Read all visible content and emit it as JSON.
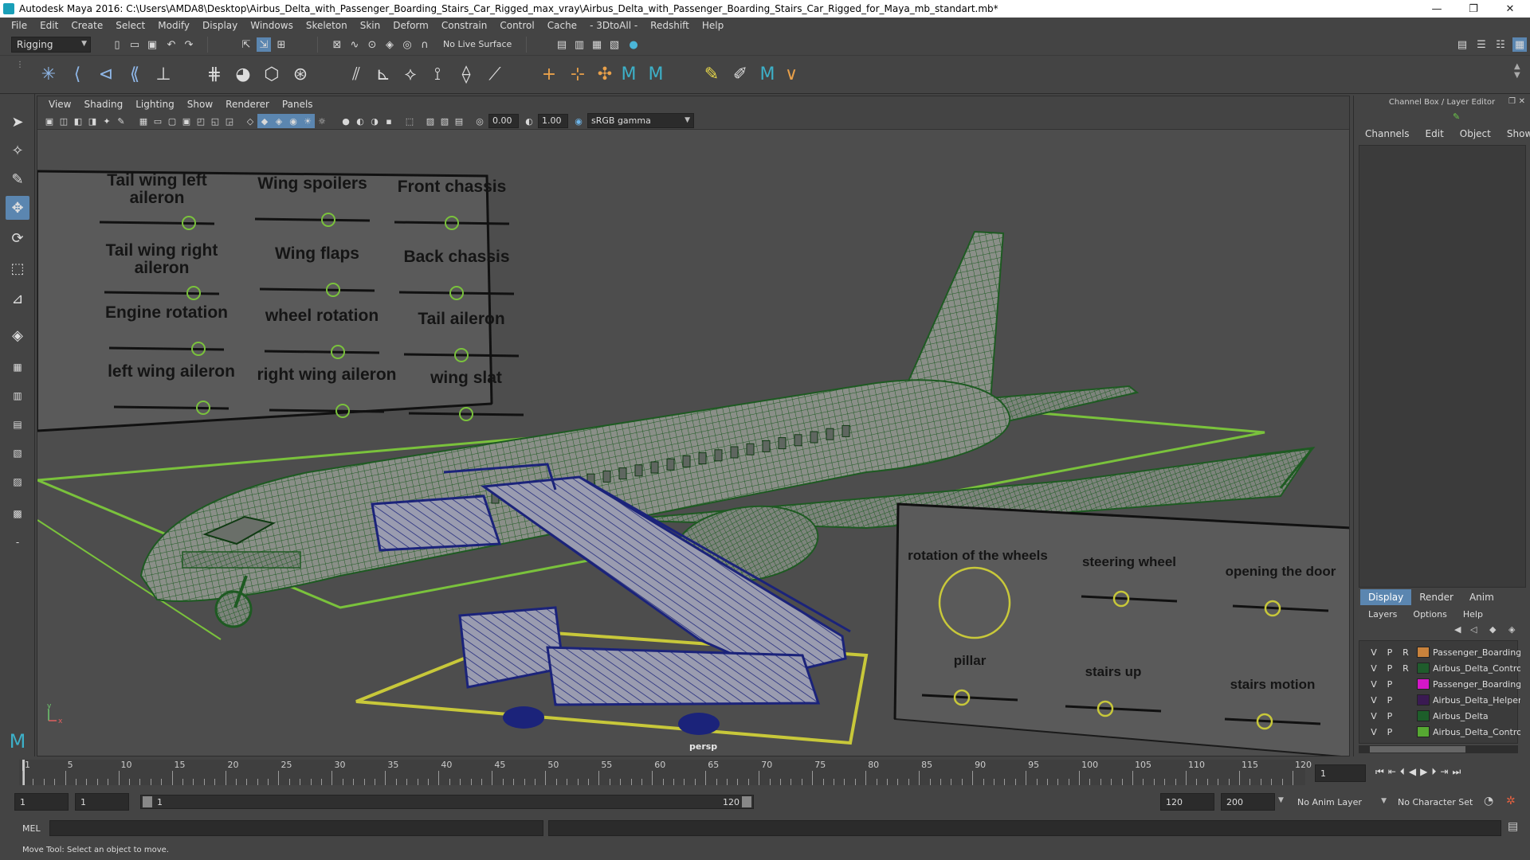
{
  "window": {
    "title": "Autodesk Maya 2016: C:\\Users\\AMDA8\\Desktop\\Airbus_Delta_with_Passenger_Boarding_Stairs_Car_Rigged_max_vray\\Airbus_Delta_with_Passenger_Boarding_Stairs_Car_Rigged_for_Maya_mb_standart.mb*",
    "minimize": "—",
    "restore": "❐",
    "close": "✕"
  },
  "menubar": [
    "File",
    "Edit",
    "Create",
    "Select",
    "Modify",
    "Display",
    "Windows",
    "Skeleton",
    "Skin",
    "Deform",
    "Constrain",
    "Control",
    "Cache",
    "- 3DtoAll -",
    "Redshift",
    "Help"
  ],
  "statusline": {
    "menuset": "Rigging",
    "live_surface": "No Live Surface"
  },
  "viewport": {
    "menu": [
      "View",
      "Shading",
      "Lighting",
      "Show",
      "Renderer",
      "Panels"
    ],
    "exposure": "0.00",
    "gamma": "1.00",
    "color_space": "sRGB gamma",
    "camera_label": "persp",
    "axis_y": "y",
    "axis_x": "x"
  },
  "airplane_controls": {
    "labels": [
      [
        "Tail wing left",
        "aileron"
      ],
      [
        "Wing spoilers"
      ],
      [
        "Front chassis"
      ],
      [
        "Tail wing right",
        "aileron"
      ],
      [
        "Wing flaps"
      ],
      [
        "Back chassis"
      ],
      [
        "Engine rotation"
      ],
      [
        "wheel rotation"
      ],
      [
        "Tail aileron"
      ],
      [
        "left wing aileron"
      ],
      [
        "right wing aileron"
      ],
      [
        "wing slat"
      ]
    ]
  },
  "stairs_controls": {
    "labels": [
      "rotation of the wheels",
      "steering wheel",
      "opening the door",
      "pillar",
      "stairs up",
      "stairs motion"
    ]
  },
  "right_panel": {
    "header": "Channel Box / Layer Editor",
    "channel_tabs": [
      "Channels",
      "Edit",
      "Object",
      "Show"
    ],
    "layer_tabs": [
      "Display",
      "Render",
      "Anim"
    ],
    "layer_menu": [
      "Layers",
      "Options",
      "Help"
    ],
    "layers": [
      {
        "v": "V",
        "p": "P",
        "r": "R",
        "color": "#c8823c",
        "name": "Passenger_Boarding"
      },
      {
        "v": "V",
        "p": "P",
        "r": "R",
        "color": "#1f5c2c",
        "name": "Airbus_Delta_Contro"
      },
      {
        "v": "V",
        "p": "P",
        "r": "",
        "color": "#d417c8",
        "name": "Passenger_Boarding"
      },
      {
        "v": "V",
        "p": "P",
        "r": "",
        "color": "#3a1a52",
        "name": "Airbus_Delta_Helper"
      },
      {
        "v": "V",
        "p": "P",
        "r": "",
        "color": "#1d5e2a",
        "name": "Airbus_Delta"
      },
      {
        "v": "V",
        "p": "P",
        "r": "",
        "color": "#56a832",
        "name": "Airbus_Delta_Contro"
      }
    ]
  },
  "timeslider": {
    "ticks": [
      "1",
      "5",
      "10",
      "15",
      "20",
      "25",
      "30",
      "35",
      "40",
      "45",
      "50",
      "55",
      "60",
      "65",
      "70",
      "75",
      "80",
      "85",
      "90",
      "95",
      "100",
      "105",
      "110",
      "115",
      "120"
    ],
    "current_frame": "1"
  },
  "rangeslider": {
    "start": "1",
    "playback_start": "1",
    "range_start_label": "1",
    "range_end_label": "120",
    "playback_end": "120",
    "end": "200",
    "anim_layer": "No Anim Layer",
    "character_set": "No Character Set"
  },
  "cmdline": {
    "label": "MEL"
  },
  "helpline": {
    "text": "Move Tool: Select an object to move."
  },
  "colors": {
    "accent": "#5b86b0",
    "wire_plane": "#1e5a22",
    "wire_stairs": "#1b237a",
    "control_yellow": "#c8c83a",
    "control_green": "#7ac23c"
  }
}
